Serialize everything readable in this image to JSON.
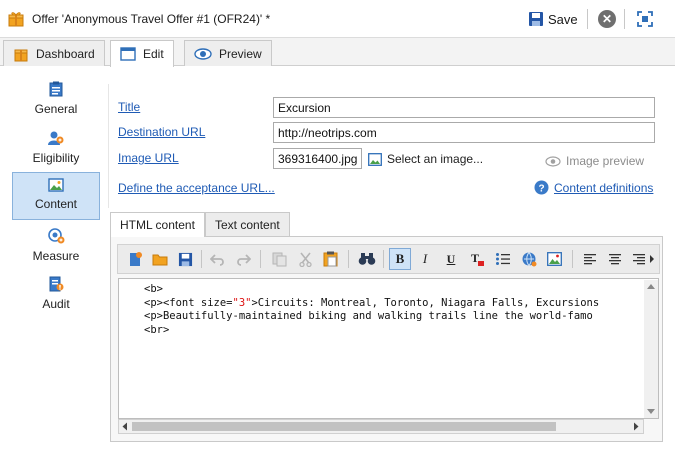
{
  "window": {
    "title": "Offer 'Anonymous Travel Offer #1 (OFR24)' *",
    "save_label": "Save",
    "close_symbol": "✕"
  },
  "tabs": [
    {
      "label": "Dashboard",
      "icon": "dashboard-icon"
    },
    {
      "label": "Edit",
      "icon": "edit-icon"
    },
    {
      "label": "Preview",
      "icon": "eye-icon"
    }
  ],
  "sidebar": {
    "items": [
      {
        "label": "General",
        "icon": "clipboard-icon"
      },
      {
        "label": "Eligibility",
        "icon": "users-icon"
      },
      {
        "label": "Content",
        "icon": "picture-icon"
      },
      {
        "label": "Measure",
        "icon": "target-icon"
      },
      {
        "label": "Audit",
        "icon": "audit-icon"
      }
    ]
  },
  "form": {
    "title_label": "Title",
    "title_value": "Excursion",
    "destination_label": "Destination URL",
    "destination_value": "http://neotrips.com",
    "image_label": "Image URL",
    "image_value": "369316400.jpg",
    "select_image_label": "Select an image...",
    "image_preview_label": "Image preview",
    "acceptance_link": "Define the acceptance URL...",
    "content_definitions_link": "Content definitions"
  },
  "content_tabs": [
    {
      "label": "HTML content"
    },
    {
      "label": "Text content"
    }
  ],
  "editor": {
    "line1": "<b>",
    "line2_pre": "<p><font size=",
    "line2_str": "\"3\"",
    "line2_post": ">Circuits: Montreal, Toronto, Niagara Falls, Excursions",
    "line3": "<p>Beautifully-maintained biking and walking trails line the world-famo",
    "line4": "<br>",
    "bold_symbol": "B",
    "italic_symbol": "I",
    "underline_symbol": "U"
  },
  "colors": {
    "link": "#1f5bb5",
    "accent_active": "#cfe3f7",
    "save_icon": "#2456a6"
  }
}
